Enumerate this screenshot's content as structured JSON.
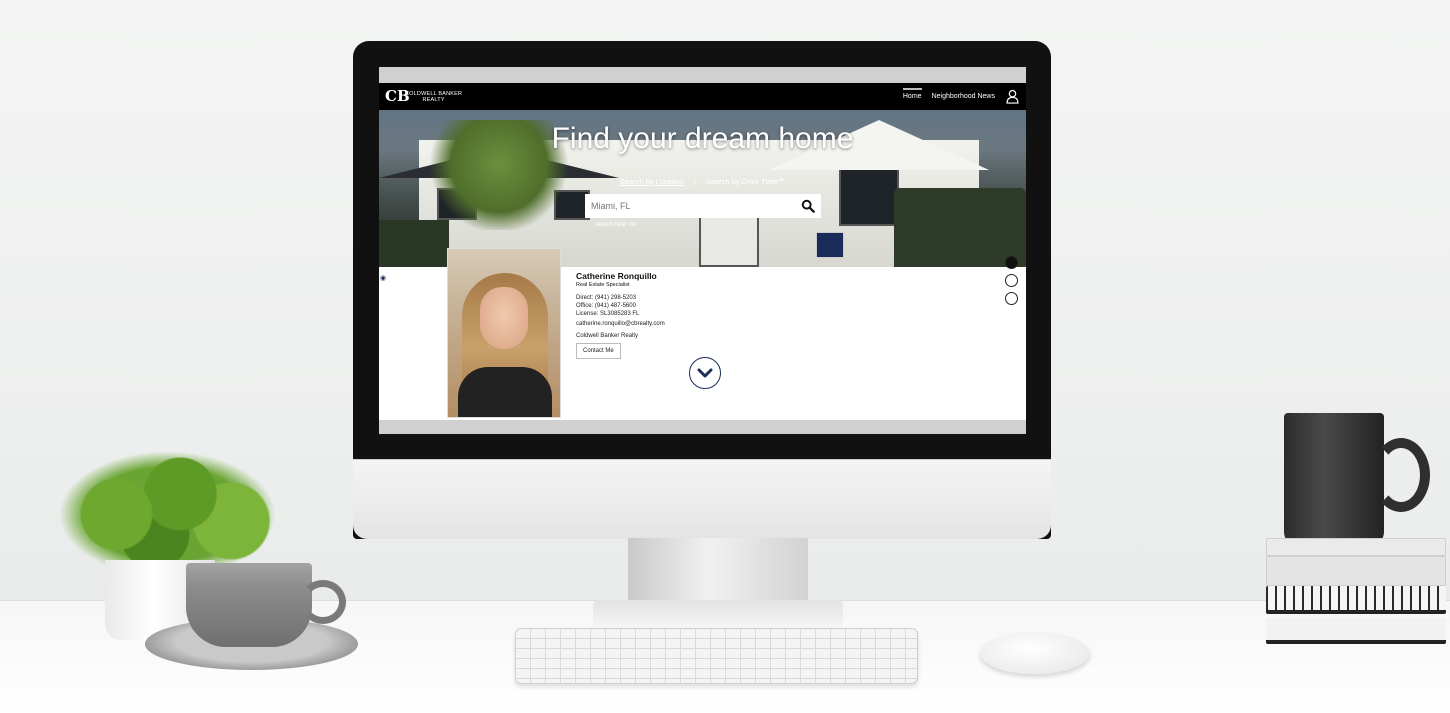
{
  "brand": {
    "logo_mark": "CB",
    "logo_line1": "COLDWELL BANKER",
    "logo_line2": "REALTY"
  },
  "nav": {
    "items": [
      {
        "label": "Home",
        "active": true
      },
      {
        "label": "Neighborhood News",
        "active": false
      }
    ],
    "user_icon": "user-icon"
  },
  "hero": {
    "title": "Find your dream home",
    "tab_location": "Search by Location",
    "separator": "|",
    "tab_drive_time": "Search by Drive Time℠",
    "search_placeholder": "Miami, FL",
    "search_near_me": "search near me"
  },
  "agent": {
    "name": "Catherine Ronquillo",
    "title": "Real Estate Specialist",
    "direct": "Direct: (941) 298-5203",
    "office": "Office: (941) 487-5600",
    "license": "License: SL3085283 FL",
    "email": "catherine.ronquillo@cbrealty.com",
    "company": "Coldwell Banker Realty",
    "contact_label": "Contact Me"
  },
  "carousel": {
    "slides": 3,
    "active_index": 0
  },
  "colors": {
    "nav_bg": "#000000",
    "accent_navy": "#1b2b5a",
    "panel_bg": "#ffffff"
  }
}
